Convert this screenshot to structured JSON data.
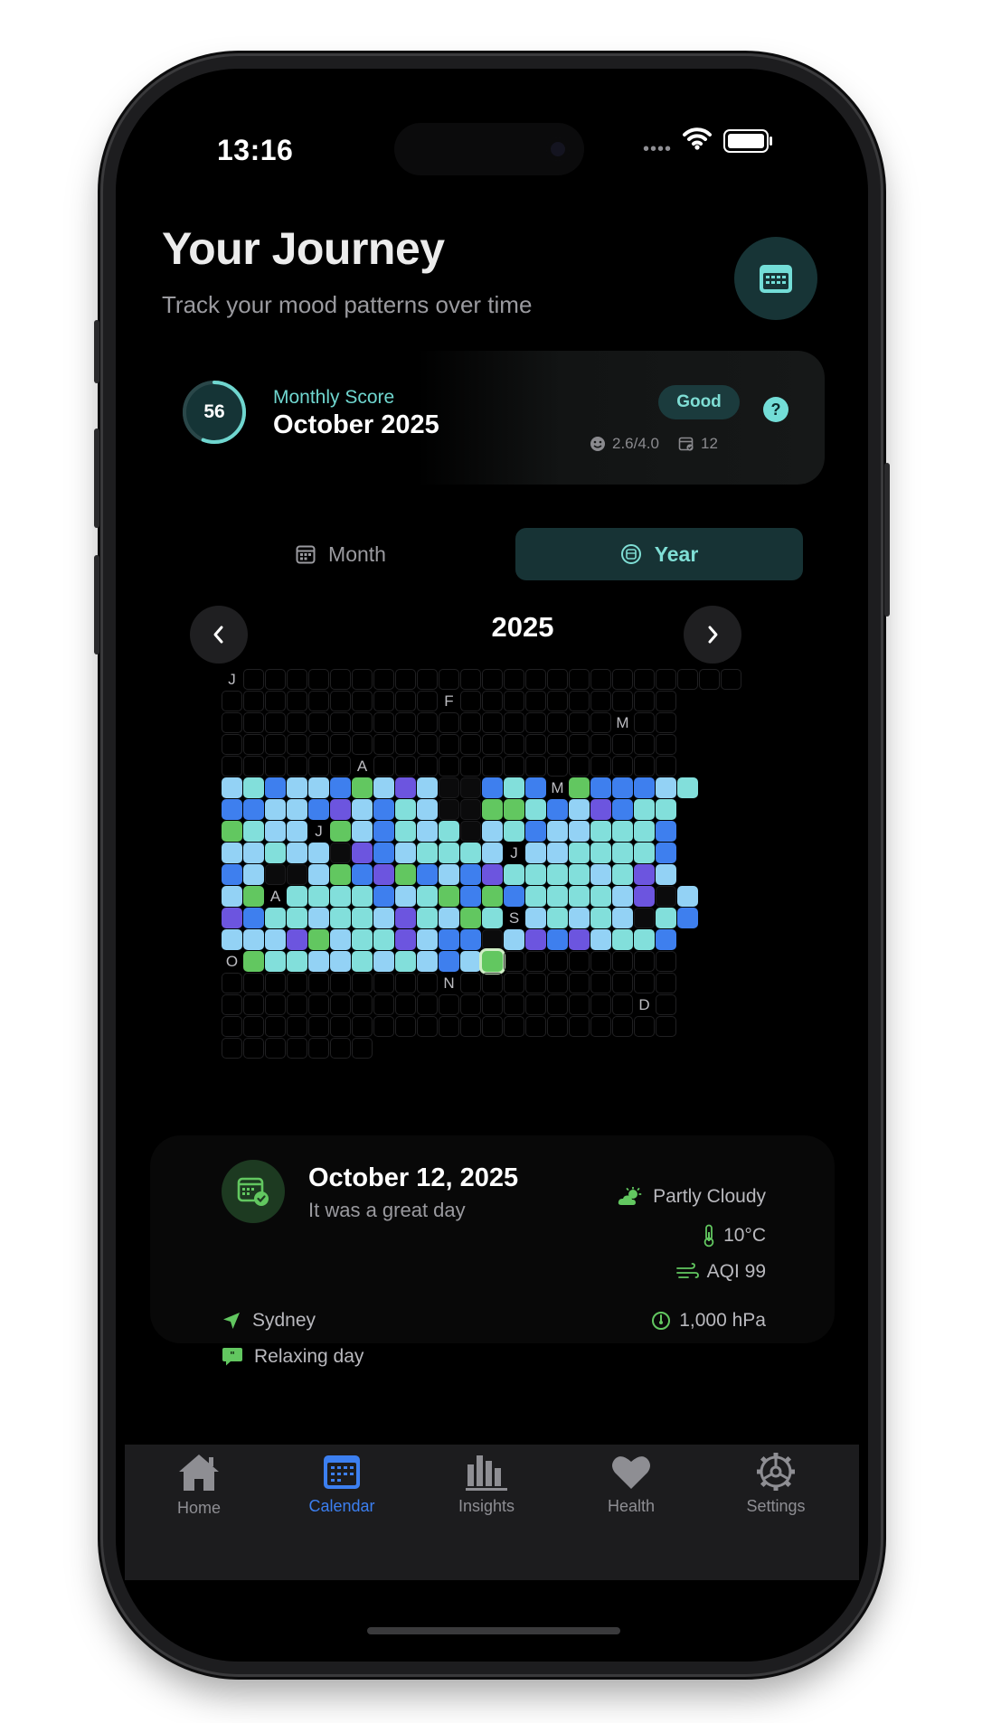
{
  "status_bar": {
    "time": "13:16",
    "dots": "••••"
  },
  "header": {
    "title": "Your Journey",
    "subtitle": "Track your mood patterns over time",
    "calendar_button_icon": "calendar-grid-icon"
  },
  "monthly_score": {
    "score": "56",
    "score_fraction": 0.56,
    "label": "Monthly Score",
    "month": "October 2025",
    "badge": "Good",
    "help": "?",
    "average": "2.6/4.0",
    "entries": "12"
  },
  "view_tabs": [
    {
      "label": "Month",
      "icon": "calendar-icon",
      "active": false
    },
    {
      "label": "Year",
      "icon": "globe-icon",
      "active": true
    }
  ],
  "year_nav": {
    "year": "2025"
  },
  "mood_grid": {
    "months": [
      "J",
      "F",
      "M",
      "A",
      "M",
      "J",
      "J",
      "A",
      "S",
      "O",
      "N",
      "D"
    ],
    "colors": {
      "a": "#82dfdb",
      "b": "#93d2f5",
      "c": "#3e7fee",
      "d": "#6c55df",
      "e": "#62c760"
    },
    "rows": [
      "J.......................",
      "..........F..........",
      "..................M..",
      ".....................",
      "......A..............",
      "bacbbcebdbxxcacMecccba",
      "ccbbcdbcabxxeeacbdcaa",
      "eabbJebcabaxbacbbaaac",
      "bbabbxdcbaaabJbbaaaac",
      "cbxxbecdecbcdaaaabadb",
      "beAaaaacbaececaaaabdxb",
      "dcaabaabdabeaSbababxac",
      "bbbdebaadbccxbdcdbaac",
      "OeaabbababcbE........",
      "..........N..........",
      "...................D.",
      ".....................",
      "......."
    ],
    "selected_day": "October 12, 2025"
  },
  "day_detail": {
    "date": "October 12, 2025",
    "note": "It was a great day",
    "weather": "Partly Cloudy",
    "temperature": "10°C",
    "aqi": "AQI 99",
    "pressure": "1,000 hPa",
    "location": "Sydney",
    "activity": "Relaxing day"
  },
  "tab_bar": [
    {
      "label": "Home",
      "icon": "house-icon",
      "active": false
    },
    {
      "label": "Calendar",
      "icon": "calendar-icon",
      "active": true
    },
    {
      "label": "Insights",
      "icon": "bar-chart-icon",
      "active": false
    },
    {
      "label": "Health",
      "icon": "heart-icon",
      "active": false
    },
    {
      "label": "Settings",
      "icon": "gear-icon",
      "active": false
    }
  ]
}
